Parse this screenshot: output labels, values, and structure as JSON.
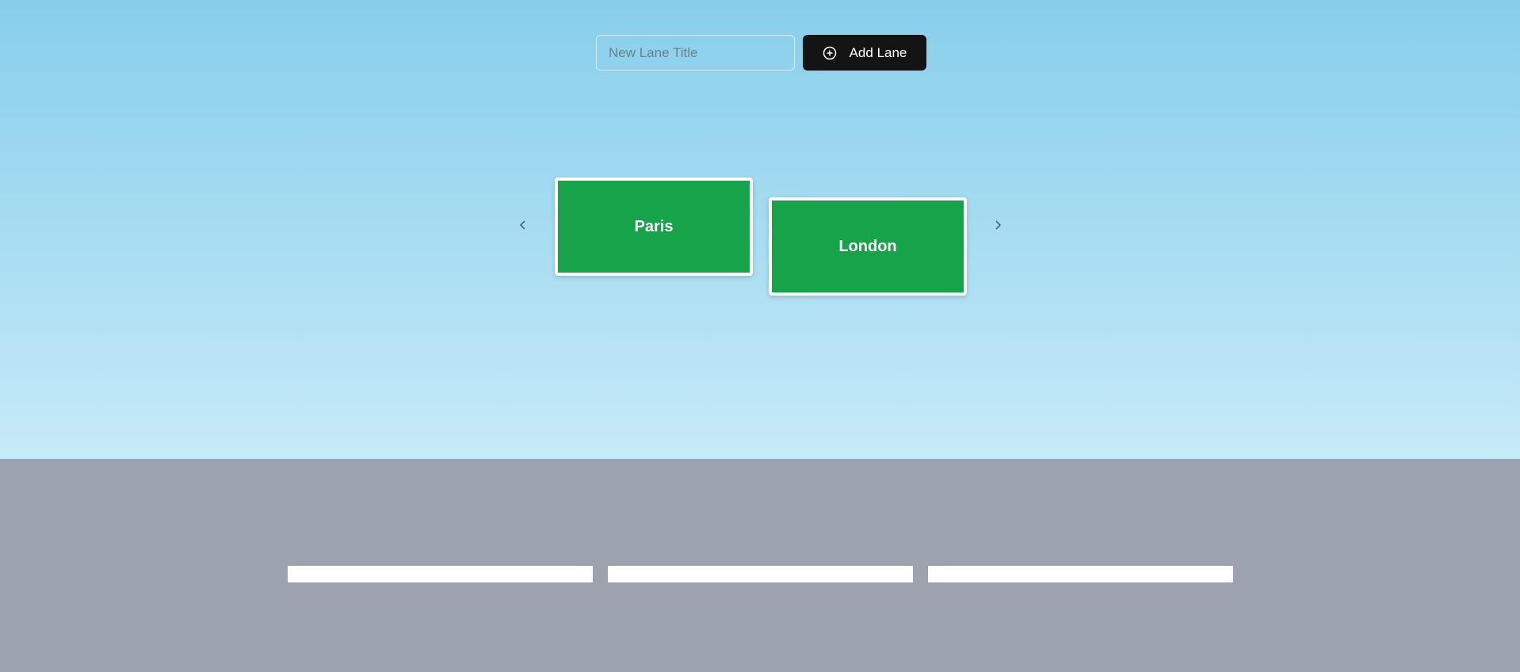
{
  "toolbar": {
    "lane_input_placeholder": "New Lane Title",
    "lane_input_value": "",
    "add_label": "Add Lane",
    "add_icon": "plus-circle-icon"
  },
  "carousel": {
    "prev_icon": "chevron-left-icon",
    "next_icon": "chevron-right-icon",
    "signs": [
      {
        "label": "Paris"
      },
      {
        "label": "London"
      }
    ]
  },
  "colors": {
    "sky_top": "#87ceeb",
    "sky_bottom": "#c6eaf8",
    "road": "#9ca3af",
    "sign_green": "#16a34a",
    "button_dark": "#141414",
    "lane_marking": "#ffffff"
  }
}
